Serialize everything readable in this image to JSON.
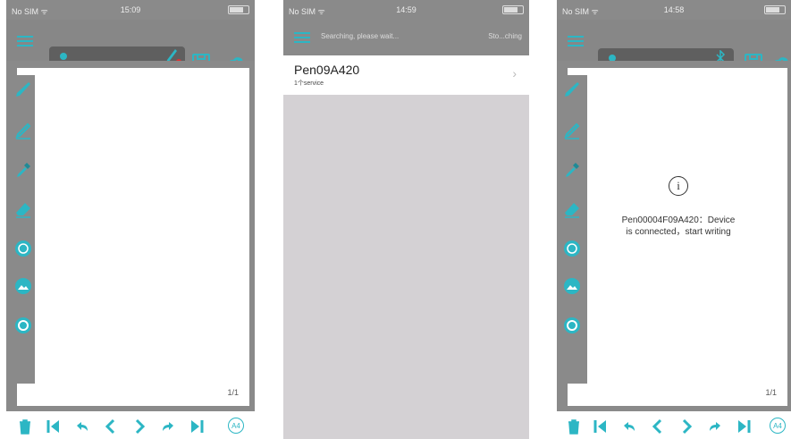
{
  "screens": [
    {
      "status": {
        "carrier": "No SIM ᯤ",
        "time": "15:09"
      },
      "page_number": "1/1",
      "bottom_badge": "A4"
    },
    {
      "status": {
        "carrier": "No SIM ᯤ",
        "time": "14:59"
      },
      "header": {
        "searching": "Searching, please wait...",
        "stop": "Sto...ching"
      },
      "device": {
        "name": "Pen09A420",
        "service": "1个service"
      }
    },
    {
      "status": {
        "carrier": "No SIM ᯤ",
        "time": "14:58"
      },
      "dialog": {
        "info_glyph": "i",
        "line1": "Pen00004F09A420：Device",
        "line2": "is connected，start writing"
      },
      "page_number": "1/1",
      "bottom_badge": "A4"
    }
  ],
  "colors": {
    "accent": "#2cb6c4",
    "bar_gray": "#878787",
    "record_red": "#e23030",
    "list_gray": "#d4d1d4"
  },
  "icons": {
    "toolbar": [
      "menu-icon",
      "save-icon",
      "cloud-upload-icon"
    ],
    "tools": [
      "pen-icon",
      "pencil-icon",
      "eyedropper-icon",
      "eraser-icon",
      "circle-tool-icon",
      "image-icon",
      "target-icon"
    ],
    "bottom": [
      "trash-icon",
      "first-page-icon",
      "undo-icon",
      "prev-icon",
      "next-icon",
      "redo-icon",
      "last-page-icon",
      "paper-size-icon"
    ]
  }
}
